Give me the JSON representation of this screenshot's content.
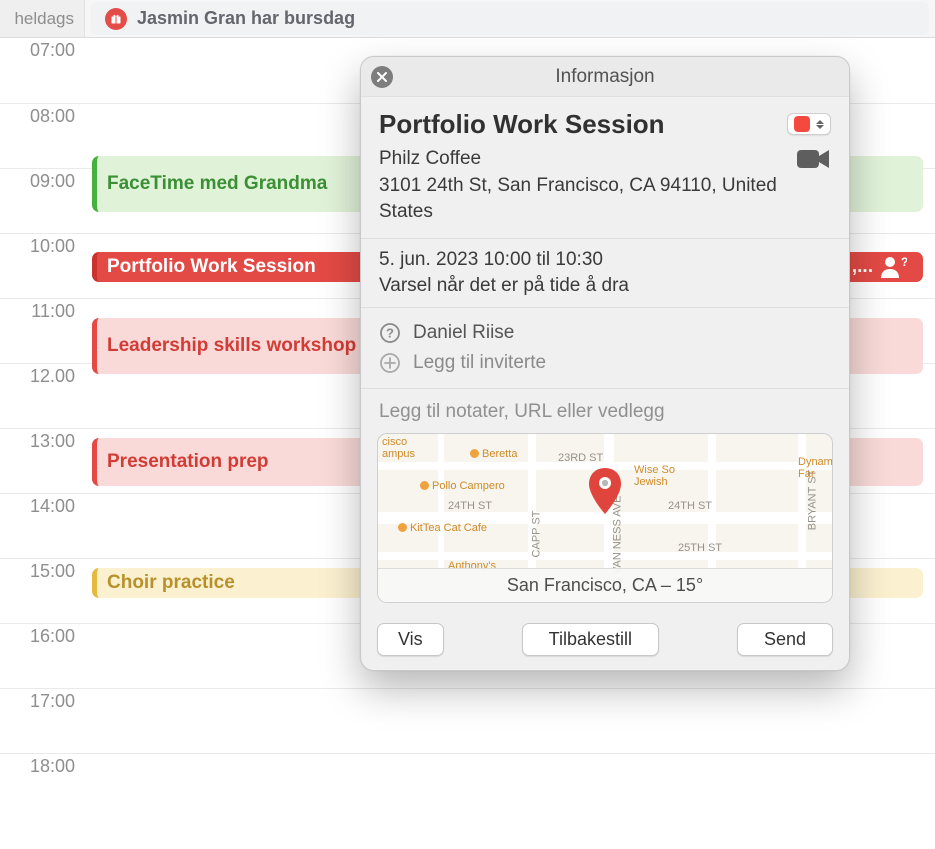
{
  "allday": {
    "label": "heldags",
    "event_title": "Jasmin Gran har bursdag"
  },
  "hours": [
    "07:00",
    "08:00",
    "09:00",
    "10:00",
    "11:00",
    "12.00",
    "13:00",
    "14:00",
    "15:00",
    "16:00",
    "17:00",
    "18:00"
  ],
  "events": {
    "facetime": "FaceTime med Grandma",
    "portfolio": "Portfolio Work Session",
    "portfolio_right_label": ",...",
    "leadership": "Leadership skills workshop",
    "presentation": "Presentation prep",
    "choir": "Choir practice"
  },
  "popover": {
    "header": "Informasjon",
    "title": "Portfolio Work Session",
    "location_name": "Philz Coffee",
    "location_addr": "3101 24th St, San Francisco, CA 94110, United States",
    "time": "5. jun. 2023  10:00 til 10:30",
    "alert": "Varsel når det er på tide å dra",
    "invitee": "Daniel Riise",
    "add_invitee": "Legg til inviterte",
    "notes_placeholder": "Legg til notater, URL eller vedlegg",
    "map_caption": "San Francisco, CA – 15°",
    "map_labels": {
      "s23": "23RD ST",
      "s24": "24TH ST",
      "s25": "25TH ST",
      "capp": "CAPP ST",
      "svanness": "S VAN NESS AVE",
      "bryant": "BRYANT ST",
      "spacer": ""
    },
    "map_poi": {
      "cisco": "cisco\nampus",
      "beretta": "Beretta",
      "pollo": "Pollo Campero",
      "wise": "Wise So\nJewish",
      "kittea": "KitTea Cat Cafe",
      "dynam": "Dynam\nFar",
      "anthony": "Anthony's"
    },
    "buttons": {
      "vis": "Vis",
      "reset": "Tilbakestill",
      "send": "Send"
    }
  }
}
